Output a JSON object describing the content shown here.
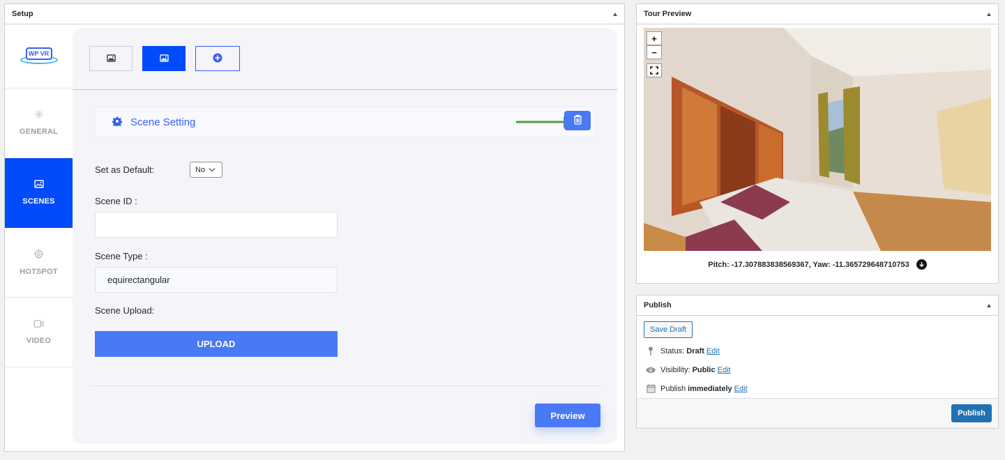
{
  "setup": {
    "title": "Setup",
    "logo_text": "WP VR",
    "side_tabs": [
      {
        "label": "GENERAL",
        "icon": "gear-icon"
      },
      {
        "label": "SCENES",
        "icon": "image-icon"
      },
      {
        "label": "HOTSPOT",
        "icon": "target-icon"
      },
      {
        "label": "VIDEO",
        "icon": "video-icon"
      }
    ],
    "active_side_tab": "SCENES",
    "scene_tabs": [
      "scene-1",
      "scene-2",
      "add-scene"
    ],
    "scene_setting_title": "Scene Setting",
    "set_default_label": "Set as Default:",
    "set_default_value": "No",
    "scene_id_label": "Scene ID :",
    "scene_id_value": "",
    "scene_type_label": "Scene Type :",
    "scene_type_value": "equirectangular",
    "scene_upload_label": "Scene Upload:",
    "upload_label": "UPLOAD",
    "preview_label": "Preview",
    "accent_color": "#004bfa",
    "button_color": "#4a79f5",
    "arrow_color": "#5a9a3c"
  },
  "tour_preview": {
    "title": "Tour Preview",
    "zoom_in": "+",
    "zoom_out": "−",
    "coords_text": "Pitch: -17.307883838569367, Yaw: -11.365729648710753"
  },
  "publish": {
    "title": "Publish",
    "save_draft_label": "Save Draft",
    "status_label": "Status:",
    "status_value": "Draft",
    "visibility_label": "Visibility:",
    "visibility_value": "Public",
    "publish_label": "Publish",
    "publish_value": "immediately",
    "edit_label": "Edit",
    "publish_button_label": "Publish",
    "button_color": "#2271b1"
  }
}
